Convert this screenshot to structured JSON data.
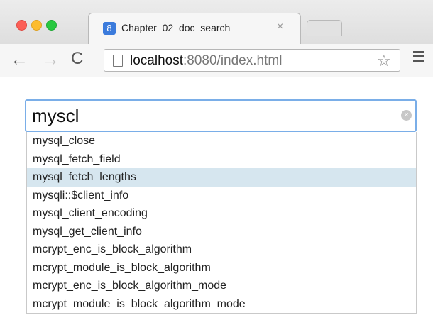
{
  "browser": {
    "tab_title": "Chapter_02_doc_search",
    "tab_close": "×",
    "favicon": "8",
    "url_host": "localhost",
    "url_rest": ":8080/index.html"
  },
  "icons": {
    "back": "←",
    "forward": "→",
    "reload": "C",
    "star": "☆",
    "clear": "×"
  },
  "search": {
    "value": "myscl"
  },
  "suggestions": [
    "mysql_close",
    "mysql_fetch_field",
    "mysql_fetch_lengths",
    "mysqli::$client_info",
    "mysql_client_encoding",
    "mysql_get_client_info",
    "mcrypt_enc_is_block_algorithm",
    "mcrypt_module_is_block_algorithm",
    "mcrypt_enc_is_block_algorithm_mode",
    "mcrypt_module_is_block_algorithm_mode"
  ],
  "highlighted_index": 2,
  "colors": {
    "highlight": "#d6e6ef",
    "focus_ring": "#7aaee8"
  }
}
